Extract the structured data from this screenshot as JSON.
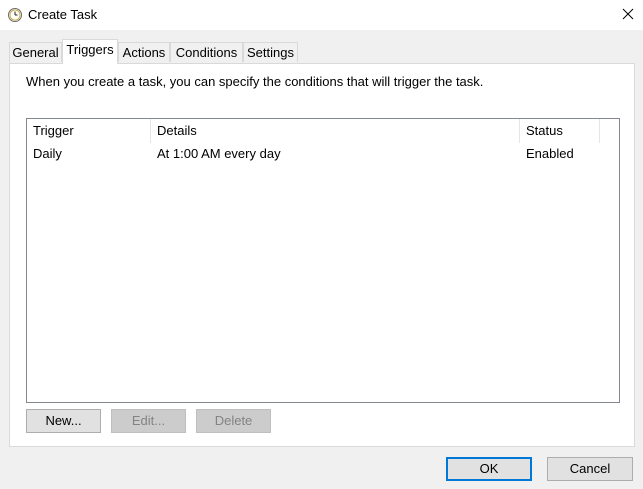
{
  "window": {
    "title": "Create Task",
    "icon": "clock-icon",
    "close_icon": "close-icon"
  },
  "tabs": [
    {
      "label": "General",
      "active": false
    },
    {
      "label": "Triggers",
      "active": true
    },
    {
      "label": "Actions",
      "active": false
    },
    {
      "label": "Conditions",
      "active": false
    },
    {
      "label": "Settings",
      "active": false
    }
  ],
  "triggers_tab": {
    "description": "When you create a task, you can specify the conditions that will trigger the task.",
    "columns": [
      "Trigger",
      "Details",
      "Status"
    ],
    "rows": [
      {
        "trigger": "Daily",
        "details": "At 1:00 AM every day",
        "status": "Enabled"
      }
    ],
    "buttons": {
      "new": "New...",
      "edit": "Edit...",
      "delete": "Delete"
    }
  },
  "dialog_buttons": {
    "ok": "OK",
    "cancel": "Cancel"
  },
  "colors": {
    "accent": "#0078d7",
    "dialog_bg": "#f0f0f0",
    "panel_bg": "#ffffff",
    "disabled_text": "#838383"
  }
}
